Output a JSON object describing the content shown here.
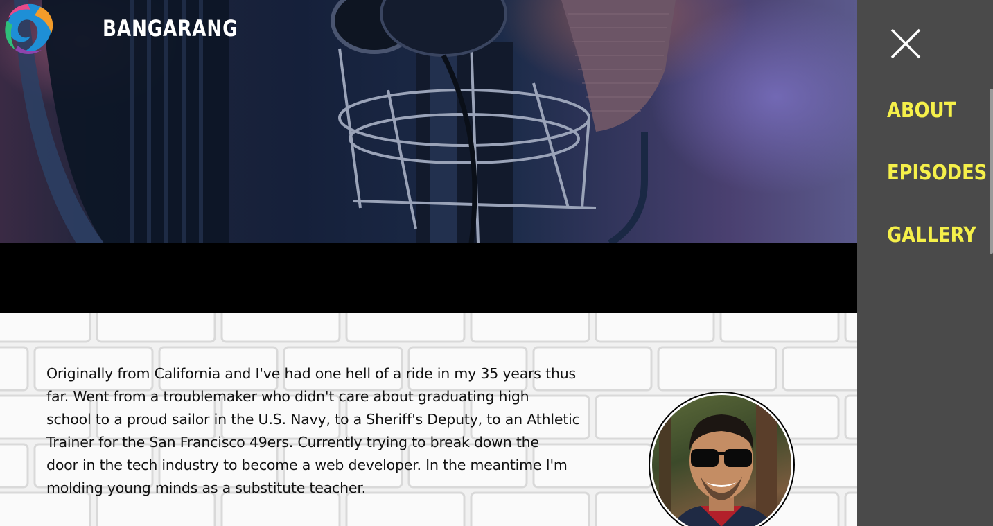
{
  "header": {
    "brand": "BANGARANG",
    "logo_icon": "swirl-logo-icon"
  },
  "menu": {
    "close_icon": "close-icon",
    "items": [
      {
        "label": "ABOUT"
      },
      {
        "label": "EPISODES"
      },
      {
        "label": "GALLERY"
      }
    ],
    "color": "#f5f04a",
    "background": "#4a4a4a"
  },
  "about": {
    "bio_lines": [
      "Originally from California and I've had one hell of a ride in my 35 years thus",
      "far. Went from a troublemaker who didn't care about graduating high",
      "school to a proud sailor in the U.S. Navy, to a Sheriff's Deputy, to an Athletic",
      "Trainer for the San Francisco 49ers. Currently trying to break down the",
      "door in the tech industry to become a web developer. In the meantime I'm",
      "molding young minds as a substitute teacher."
    ]
  }
}
